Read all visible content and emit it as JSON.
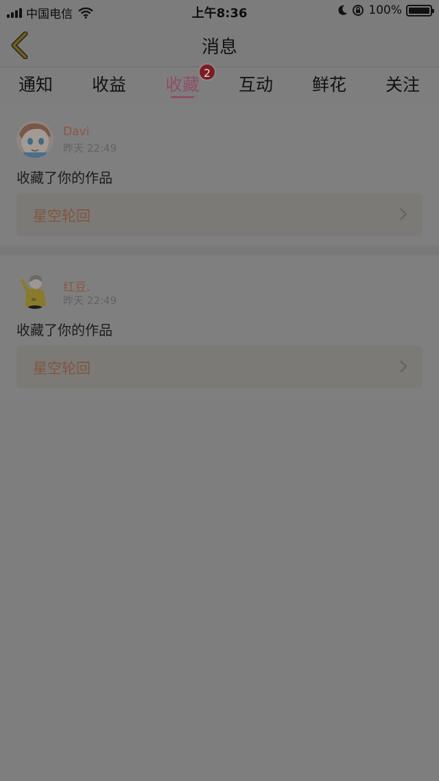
{
  "status_bar": {
    "carrier": "中国电信",
    "time": "上午8:36",
    "battery": "100%",
    "battery_level": 1.0,
    "signal_icon": "signal-bars-icon",
    "wifi_icon": "wifi-icon",
    "moon_icon": "moon-icon",
    "lock_icon": "rotation-lock-icon"
  },
  "header": {
    "title": "消息",
    "back_icon": "chevron-left-icon"
  },
  "tabs": [
    {
      "label": "通知"
    },
    {
      "label": "收益"
    },
    {
      "label": "收藏",
      "active": true,
      "badge": "2"
    },
    {
      "label": "互动"
    },
    {
      "label": "鲜花"
    },
    {
      "label": "关注"
    }
  ],
  "notifications": [
    {
      "user": "Davi",
      "time": "昨天 22:49",
      "action": "收藏了你的作品",
      "work": "星空轮回"
    },
    {
      "user": "红豆.",
      "time": "昨天 22:49",
      "action": "收藏了你的作品",
      "work": "星空轮回"
    }
  ],
  "colors": {
    "overlay_bg": "#7f7e7f",
    "accent": "#8e4d68",
    "badge": "#7d1c22",
    "back_arrow": "#6b5a1e"
  }
}
